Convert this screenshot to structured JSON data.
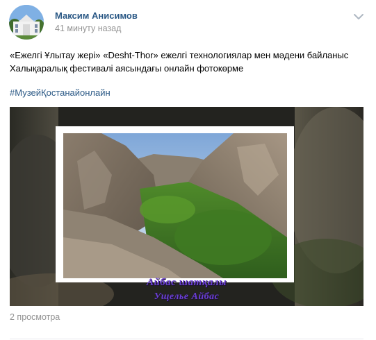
{
  "post": {
    "author": "Максим Анисимов",
    "time": "41 минуту назад",
    "text": "«Ежелгі Ұлытау жері» «Desht-Thor» ежелгі технологиялар мен мәдени байланыс Халықаралық фестивалі аясындағы онлайн фотокөрме",
    "hashtag": "#МузейҚостанайонлайн",
    "video": {
      "caption_line1": "Айбас шатқалы",
      "caption_line2": "Ущелье Айбас"
    },
    "views": "2 просмотра"
  },
  "icons": {
    "more": "chevron-down-icon"
  },
  "colors": {
    "link": "#2a5885",
    "muted": "#939393",
    "caption": "#6a3ed6"
  }
}
